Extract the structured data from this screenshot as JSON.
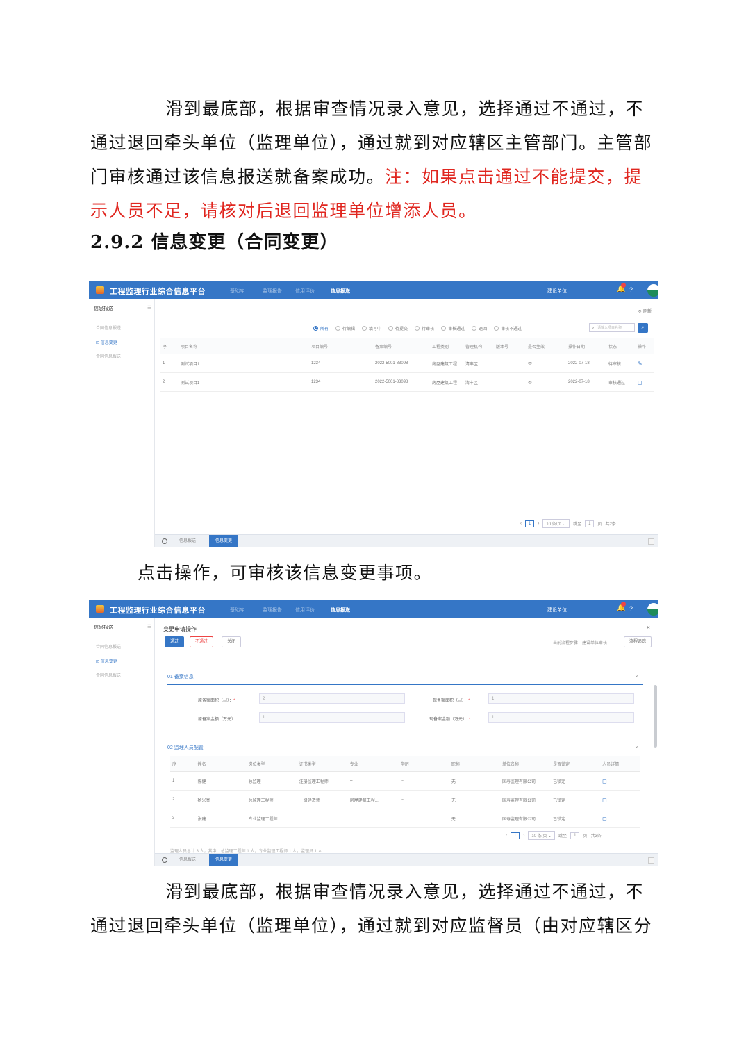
{
  "para1": {
    "text": "滑到最底部，根据审查情况录入意见，选择通过不通过，不通过退回牵头单位（监理单位），通过就到对应辖区主管部门。主管部门审核通过该信息报送就备案成功。",
    "note": "注：如果点击通过不能提交，提示人员不足，请核对后退回监理单位增添人员。"
  },
  "heading": "2.9.2 信息变更（合同变更）",
  "para2": "点击操作，可审核该信息变更事项。",
  "para3": "滑到最底部，根据审查情况录入意见，选择通过不通过，不通过退回牵头单位（监理单位），通过就到对应监督员（由对应辖区分",
  "app": {
    "title": "工程监理行业综合信息平台",
    "nav": [
      "基础库",
      "监理报告",
      "信用评价",
      "信息报送"
    ],
    "user": "建设单位",
    "sidebar_title": "信息报送",
    "sidebar_items": [
      "合同信息报送",
      "信息变更",
      "合同信息报送"
    ],
    "bottom_tabs": [
      "信息报送",
      "信息变更"
    ]
  },
  "shot1": {
    "refresh": "刷新",
    "filters": [
      "所有",
      "待编辑",
      "填写中",
      "待提交",
      "待审核",
      "审核通过",
      "退回",
      "审核不通过"
    ],
    "search_placeholder": "请输入项目名称",
    "columns": [
      "序",
      "项目名称",
      "项目编号",
      "备案编号",
      "工程类别",
      "管理机构",
      "版本号",
      "是否生效",
      "操作日期",
      "状态",
      "操作"
    ],
    "rows": [
      [
        "1",
        "测试项目1",
        "1234",
        "2022-5001-83098",
        "房屋建筑工程",
        "清丰区",
        "",
        "否",
        "2022-07-18",
        "待审核"
      ],
      [
        "2",
        "测试项目1",
        "1234",
        "2022-5001-83098",
        "房屋建筑工程",
        "清丰区",
        "",
        "否",
        "2022-07-18",
        "审核通过"
      ]
    ],
    "pager": {
      "page": "1",
      "size": "10 条/页",
      "goto_label": "跳至",
      "goto": "1",
      "page_unit": "页",
      "total": "共2条"
    }
  },
  "shot2": {
    "dialog_title": "变更申请操作",
    "buttons": [
      "通过",
      "不通过",
      "关闭"
    ],
    "step_info": "当前流程步骤：建设单位审核",
    "track_button": "流程追踪",
    "sec1": "01 备案信息",
    "fields": [
      {
        "label": "原备案面积（㎡）：",
        "value": "2"
      },
      {
        "label": "现备案面积（㎡）：",
        "value": "1"
      },
      {
        "label": "原备案金额（万元）：",
        "value": "1"
      },
      {
        "label": "现备案金额（万元）：",
        "value": "1"
      }
    ],
    "sec2": "02 监理人员配置",
    "columns": [
      "序",
      "姓名",
      "岗位类型",
      "证书类型",
      "专业",
      "学历",
      "职称",
      "单位名称",
      "是否锁定",
      "人员详情"
    ],
    "rows": [
      [
        "1",
        "陈健",
        "总监理",
        "注册监理工程师",
        "--",
        "--",
        "无",
        "国寿监理有限公司",
        "已锁定"
      ],
      [
        "2",
        "杨兴亮",
        "总监理工程师",
        "一级建造师",
        "房屋建筑工程,...",
        "--",
        "无",
        "国寿监理有限公司",
        "已锁定"
      ],
      [
        "3",
        "张建",
        "专业监理工程师",
        "--",
        "--",
        "--",
        "无",
        "国寿监理有限公司",
        "已锁定"
      ]
    ],
    "pager": {
      "page": "1",
      "size": "10 条/页",
      "goto_label": "跳至",
      "goto": "1",
      "page_unit": "页",
      "total": "共3条"
    },
    "cut_text": "监理人员总计 3 人，其中：总监理工程师 1 人，专业监理工程师 1 人，监理员 1 人"
  }
}
